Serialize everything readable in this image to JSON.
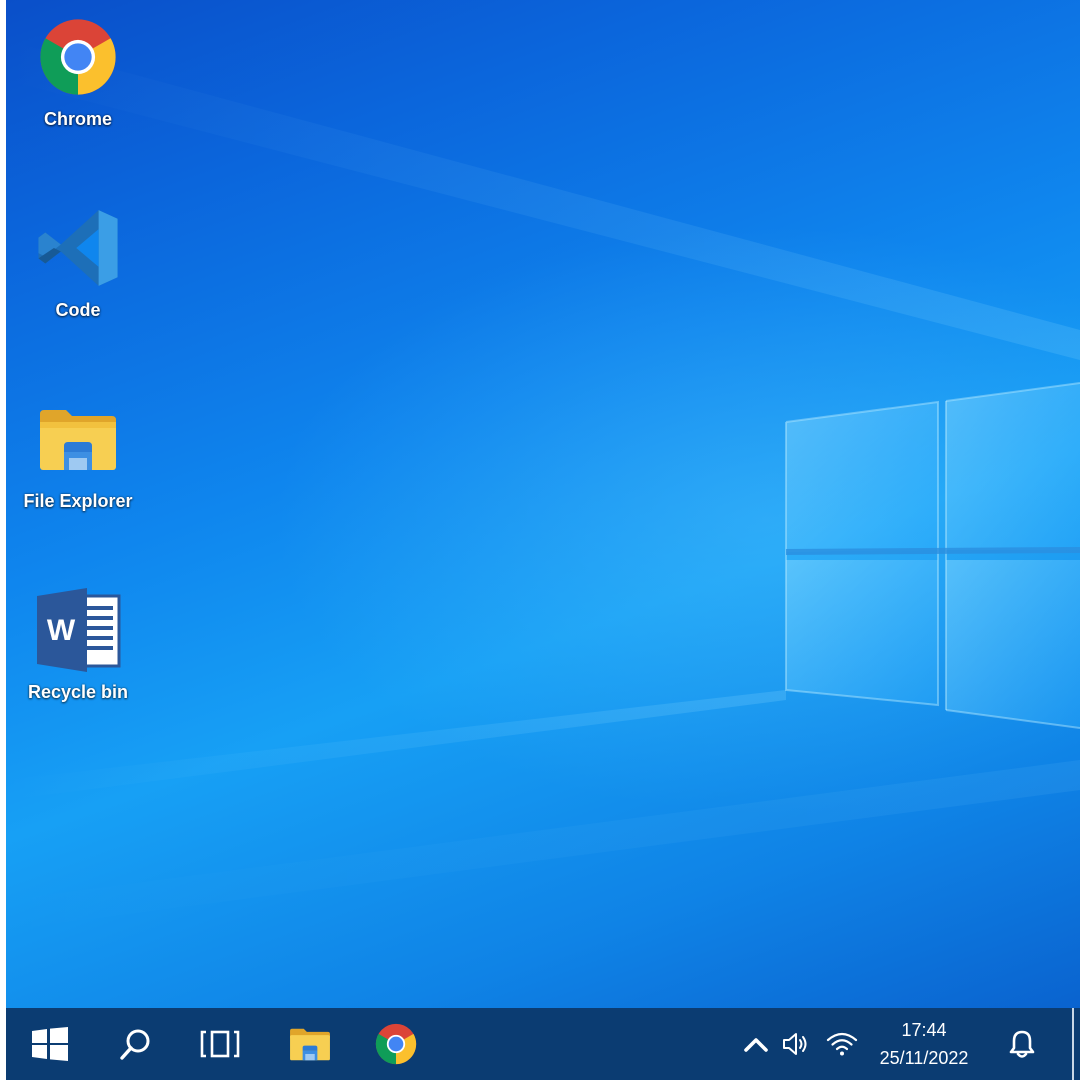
{
  "desktop": {
    "icons": [
      {
        "label": "Chrome",
        "icon": "chrome-icon"
      },
      {
        "label": "Code",
        "icon": "vscode-icon"
      },
      {
        "label": "File Explorer",
        "icon": "folder-icon"
      },
      {
        "label": "Recycle bin",
        "icon": "word-document-icon"
      }
    ]
  },
  "taskbar": {
    "items": [
      {
        "icon": "windows-start-icon"
      },
      {
        "icon": "search-icon"
      },
      {
        "icon": "task-view-icon"
      },
      {
        "icon": "file-explorer-icon"
      },
      {
        "icon": "chrome-icon"
      }
    ],
    "tray": {
      "icons": [
        "chevron-up-icon",
        "volume-icon",
        "wifi-icon",
        "notification-bell-icon"
      ],
      "time": "17:44",
      "date": "25/11/2022"
    }
  },
  "colors": {
    "taskbar": "#0b3c72",
    "wallpaper_accent": "#1ea2f7",
    "label_text": "#ffffff"
  }
}
